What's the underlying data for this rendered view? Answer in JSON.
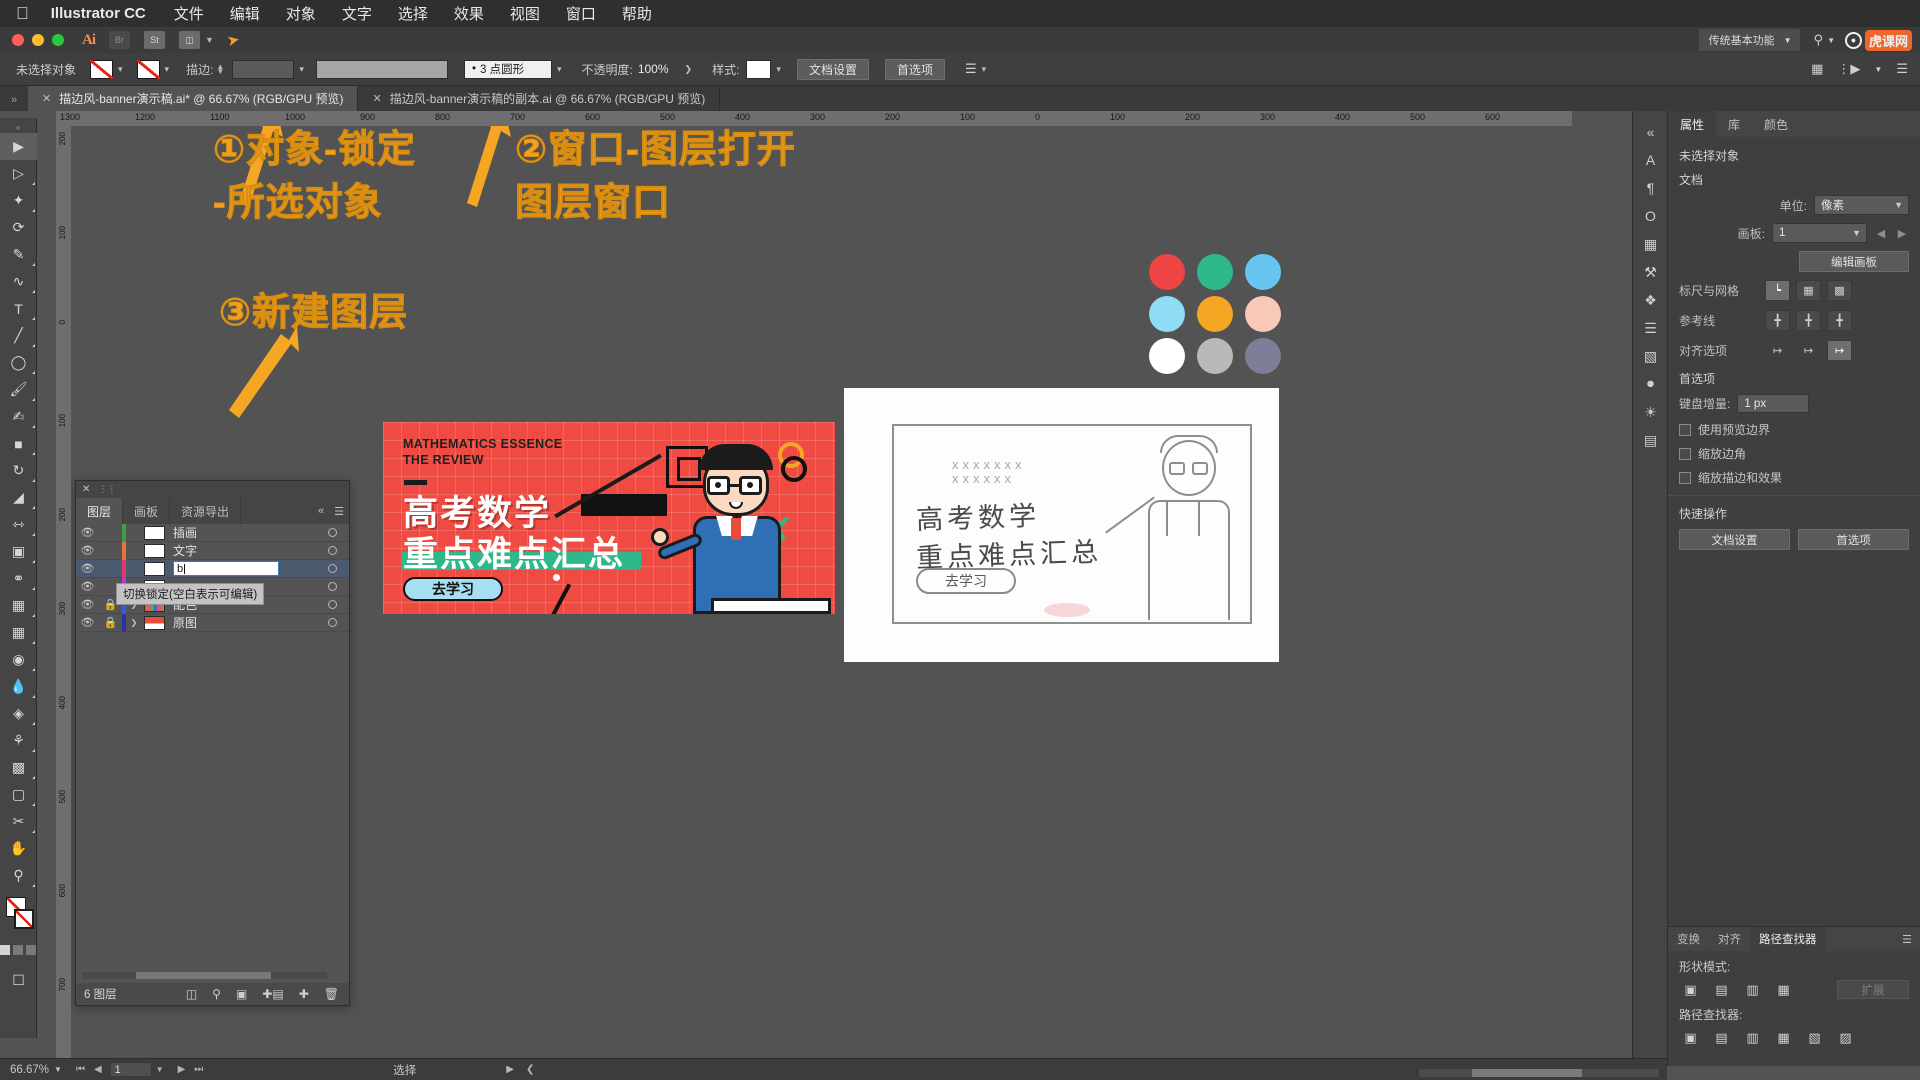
{
  "macmenu": {
    "app": "Illustrator CC",
    "items": [
      "文件",
      "编辑",
      "对象",
      "文字",
      "选择",
      "效果",
      "视图",
      "窗口",
      "帮助"
    ]
  },
  "approw": {
    "workspace": "传统基本功能",
    "search_placeholder": "",
    "watermark": "虎课网"
  },
  "control": {
    "selection_label": "未选择对象",
    "stroke_label": "描边:",
    "brush": "3 点圆形",
    "opacity_label": "不透明度:",
    "opacity_value": "100%",
    "style_label": "样式:",
    "doc_setup": "文档设置",
    "preferences": "首选项"
  },
  "tabs": [
    {
      "title": "描边风-banner演示稿.ai* @ 66.67% (RGB/GPU 预览)",
      "active": true
    },
    {
      "title": "描边风-banner演示稿的副本.ai @ 66.67% (RGB/GPU 预览)",
      "active": false
    }
  ],
  "ruler": {
    "h_ticks": [
      "1300",
      "1200",
      "1100",
      "1000",
      "900",
      "800",
      "700",
      "600",
      "500",
      "400",
      "300",
      "200",
      "100",
      "0",
      "100",
      "200",
      "300",
      "400",
      "500",
      "600"
    ],
    "v_ticks": [
      "200",
      "100",
      "0",
      "100",
      "200",
      "300",
      "400",
      "500",
      "600",
      "700"
    ]
  },
  "annotations": [
    {
      "id": "a1",
      "line1": "①对象-锁定",
      "line2": "-所选对象"
    },
    {
      "id": "a2",
      "line1": "②窗口-图层打开",
      "line2": "图层窗口"
    },
    {
      "id": "a3",
      "line1": "③新建图层",
      "line2": ""
    }
  ],
  "layers_panel": {
    "tabs": [
      "图层",
      "画板",
      "资源导出"
    ],
    "active_tab": "图层",
    "rows": [
      {
        "name": "插画",
        "color": "#3f9e4d",
        "visible": true,
        "locked": false,
        "expandable": false,
        "selected": false,
        "editing": false
      },
      {
        "name": "文字",
        "color": "#e8733a",
        "visible": true,
        "locked": false,
        "expandable": false,
        "selected": false,
        "editing": false
      },
      {
        "name": "b",
        "color": "#e03a6d",
        "visible": true,
        "locked": false,
        "expandable": false,
        "selected": true,
        "editing": true
      },
      {
        "name": "",
        "color": "#b23ad8",
        "visible": true,
        "locked": false,
        "expandable": false,
        "selected": false,
        "editing": false
      },
      {
        "name": "配色",
        "color": "#2f5fd0",
        "visible": true,
        "locked": true,
        "expandable": true,
        "selected": false,
        "editing": false
      },
      {
        "name": "原图",
        "color": "#2f2fa8",
        "visible": true,
        "locked": true,
        "expandable": true,
        "selected": false,
        "editing": false
      }
    ],
    "tooltip": "切换锁定(空白表示可编辑)",
    "footer_count": "6 图层",
    "edit_value": "b"
  },
  "properties": {
    "tabs": [
      "属性",
      "库",
      "颜色"
    ],
    "active_tab": "属性",
    "no_selection": "未选择对象",
    "doc_header": "文档",
    "unit_label": "单位:",
    "unit_value": "像素",
    "artboard_label": "画板:",
    "artboard_value": "1",
    "edit_artboard": "编辑画板",
    "ruler_grid_label": "标尺与网格",
    "guides_label": "参考线",
    "align_label": "对齐选项",
    "prefs_header": "首选项",
    "keyboard_label": "键盘增量:",
    "keyboard_value": "1 px",
    "checks": [
      "使用预览边界",
      "缩放边角",
      "缩放描边和效果"
    ],
    "quick_header": "快速操作",
    "quick_buttons": [
      "文档设置",
      "首选项"
    ]
  },
  "pathfinder": {
    "tabs": [
      "变换",
      "对齐",
      "路径查找器"
    ],
    "active_tab": "路径查找器",
    "shape_mode_label": "形状模式:",
    "expand_label": "扩展",
    "pathfinder_label": "路径查找器:"
  },
  "status": {
    "zoom": "66.67%",
    "page": "1",
    "tool": "选择"
  },
  "banner": {
    "en_line1": "MATHEMATICS ESSENCE",
    "en_line2": "THE REVIEW",
    "cn_line1": "高考数学",
    "cn_line2": "重点难点汇总",
    "button": "去学习"
  },
  "sketch": {
    "cn_line1": "高考数学",
    "cn_line2": "重点难点汇总",
    "button": "去学习"
  },
  "swatches": [
    [
      "#ef4444",
      "#2fb98a",
      "#67c6ef"
    ],
    [
      "#8fdcf5",
      "#f5a623",
      "#f7c9b6"
    ],
    [
      "#ffffff",
      "#b9b9b9",
      "#7d7f99"
    ]
  ]
}
